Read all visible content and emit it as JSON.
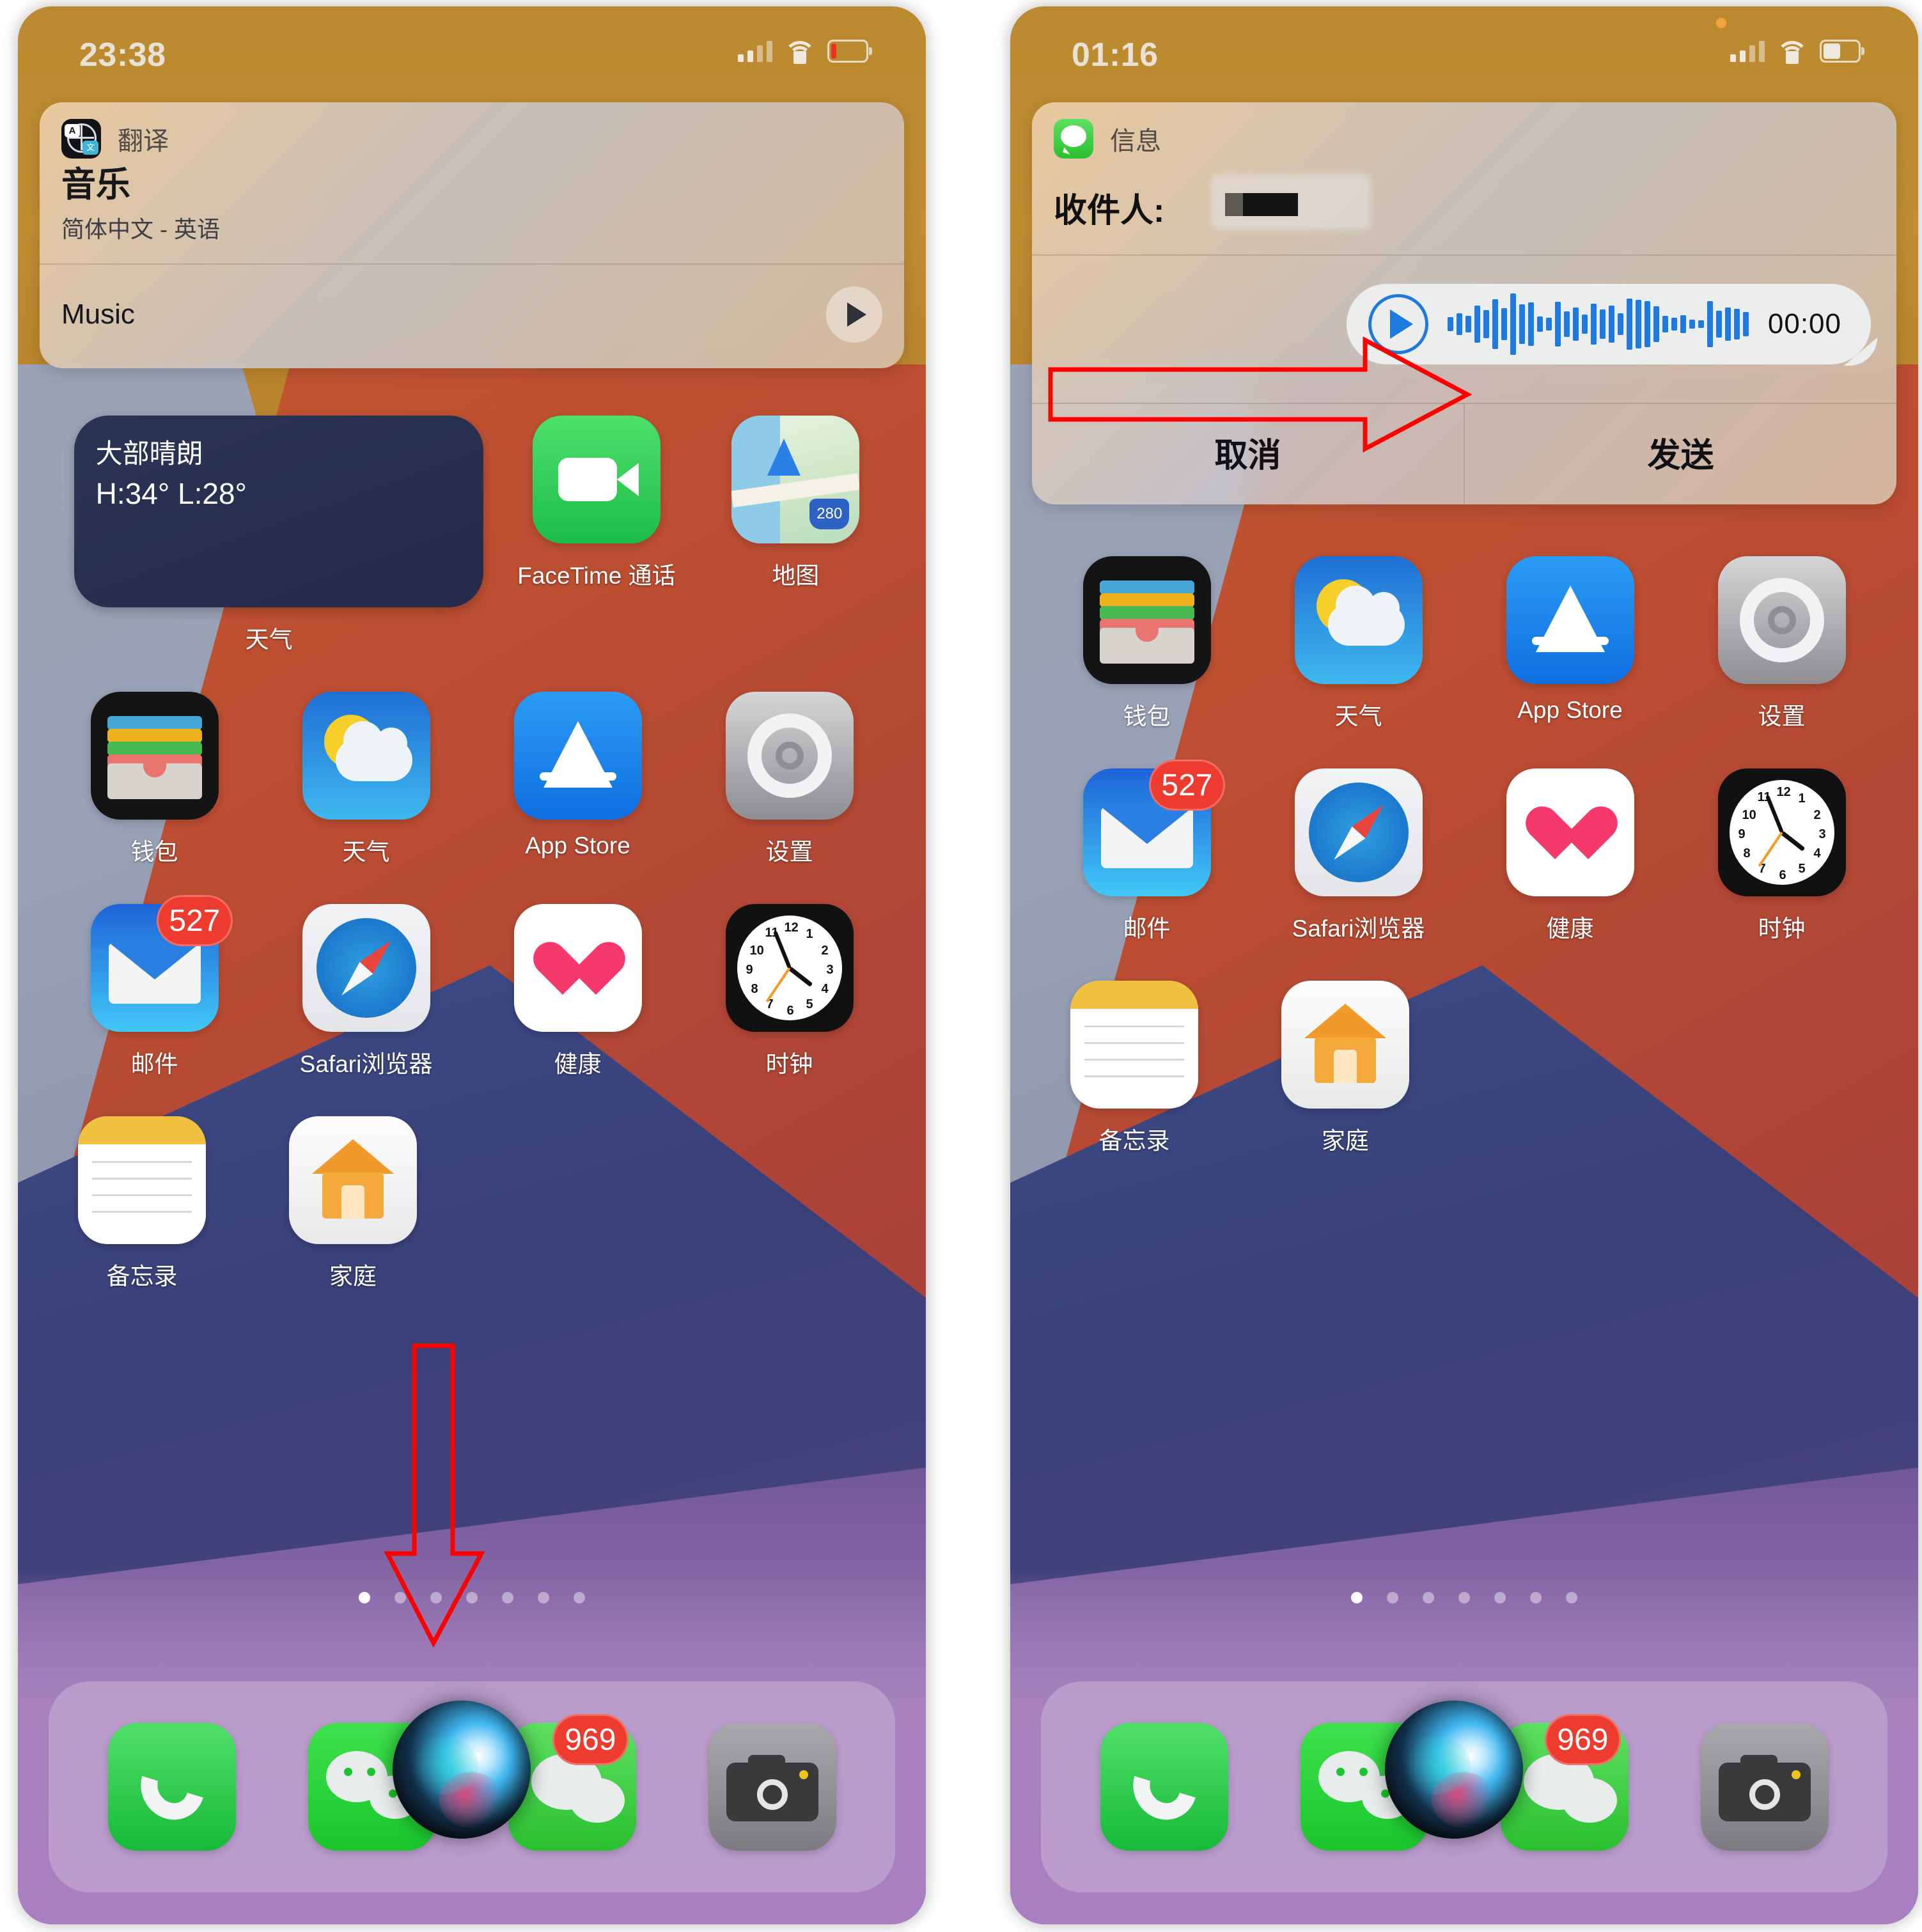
{
  "meta": {
    "accent_red": "#ff0000",
    "badge_color": "#ee3b30",
    "waveform_color": "#1f7ae0"
  },
  "left_phone": {
    "status_bar": {
      "time": "23:38",
      "signal_icon": "cellular-signal-icon",
      "wifi_icon": "wifi-icon",
      "battery_icon": "battery-low-icon",
      "battery_level_color": "#ee3124"
    },
    "notification": {
      "app_icon": "translate-app-icon",
      "app_name": "翻译",
      "title": "音乐",
      "subtitle": "简体中文 - 英语",
      "result_text": "Music",
      "play_button_icon": "play-icon"
    },
    "widget": {
      "name": "weather-widget",
      "condition": "大部晴朗",
      "temps": "H:34° L:28°",
      "label": "天气"
    },
    "rows": [
      {
        "apps": [
          {
            "label": "天气",
            "icon": "weather-widget-large",
            "badge": null
          },
          {
            "label": "FaceTime 通话",
            "icon": "facetime-icon",
            "badge": null
          },
          {
            "label": "地图",
            "icon": "maps-icon",
            "badge": null
          }
        ]
      },
      {
        "apps": [
          {
            "label": "钱包",
            "icon": "wallet-icon",
            "badge": null
          },
          {
            "label": "天气",
            "icon": "weather-icon",
            "badge": null
          },
          {
            "label": "App Store",
            "icon": "appstore-icon",
            "badge": null
          },
          {
            "label": "设置",
            "icon": "settings-icon",
            "badge": null
          }
        ]
      },
      {
        "apps": [
          {
            "label": "邮件",
            "icon": "mail-icon",
            "badge": "527"
          },
          {
            "label": "Safari浏览器",
            "icon": "safari-icon",
            "badge": null
          },
          {
            "label": "健康",
            "icon": "health-icon",
            "badge": null
          },
          {
            "label": "时钟",
            "icon": "clock-icon",
            "badge": null
          }
        ]
      },
      {
        "apps": [
          {
            "label": "备忘录",
            "icon": "notes-icon",
            "badge": null
          },
          {
            "label": "家庭",
            "icon": "home-icon",
            "badge": null
          }
        ]
      }
    ],
    "page_dots": {
      "count": 7,
      "active_index": 0
    },
    "dock": [
      {
        "label": "电话",
        "icon": "phone-icon",
        "badge": null
      },
      {
        "label": "微信",
        "icon": "wechat-icon",
        "badge": null
      },
      {
        "label": "信息",
        "icon": "messages-icon",
        "badge": "969"
      },
      {
        "label": "相机",
        "icon": "camera-icon",
        "badge": null
      }
    ],
    "siri_orb": "siri-orb",
    "annotation": {
      "type": "down-arrow",
      "color": "#ff0000"
    }
  },
  "right_phone": {
    "status_bar": {
      "time": "01:16",
      "signal_icon": "cellular-signal-icon",
      "wifi_icon": "wifi-icon",
      "battery_icon": "battery-icon",
      "recording_dot": "orange-recording-dot"
    },
    "notification": {
      "app_icon": "messages-app-icon",
      "app_name": "信息",
      "recipient_label": "收件人:",
      "recipient_value_redacted": true,
      "audio_message": {
        "play_button_icon": "play-circle-icon",
        "waveform_icon": "audio-waveform",
        "duration": "00:00"
      },
      "actions": [
        {
          "label": "取消",
          "name": "cancel-button"
        },
        {
          "label": "发送",
          "name": "send-button"
        }
      ]
    },
    "rows": [
      {
        "apps": [
          {
            "label": "钱包",
            "icon": "wallet-icon",
            "badge": null
          },
          {
            "label": "天气",
            "icon": "weather-icon",
            "badge": null
          },
          {
            "label": "App Store",
            "icon": "appstore-icon",
            "badge": null
          },
          {
            "label": "设置",
            "icon": "settings-icon",
            "badge": null
          }
        ]
      },
      {
        "apps": [
          {
            "label": "邮件",
            "icon": "mail-icon",
            "badge": "527"
          },
          {
            "label": "Safari浏览器",
            "icon": "safari-icon",
            "badge": null
          },
          {
            "label": "健康",
            "icon": "health-icon",
            "badge": null
          },
          {
            "label": "时钟",
            "icon": "clock-icon",
            "badge": null
          }
        ]
      },
      {
        "apps": [
          {
            "label": "备忘录",
            "icon": "notes-icon",
            "badge": null
          },
          {
            "label": "家庭",
            "icon": "home-icon",
            "badge": null
          }
        ]
      }
    ],
    "page_dots": {
      "count": 7,
      "active_index": 0
    },
    "dock": [
      {
        "label": "电话",
        "icon": "phone-icon",
        "badge": null
      },
      {
        "label": "微信",
        "icon": "wechat-icon",
        "badge": null
      },
      {
        "label": "信息",
        "icon": "messages-icon",
        "badge": "969"
      },
      {
        "label": "相机",
        "icon": "camera-icon",
        "badge": null
      }
    ],
    "siri_orb": "siri-orb",
    "annotation": {
      "type": "right-arrow",
      "color": "#ff0000"
    }
  },
  "clock_numerals": [
    "12",
    "1",
    "2",
    "3",
    "4",
    "5",
    "6",
    "7",
    "8",
    "9",
    "10",
    "11"
  ]
}
